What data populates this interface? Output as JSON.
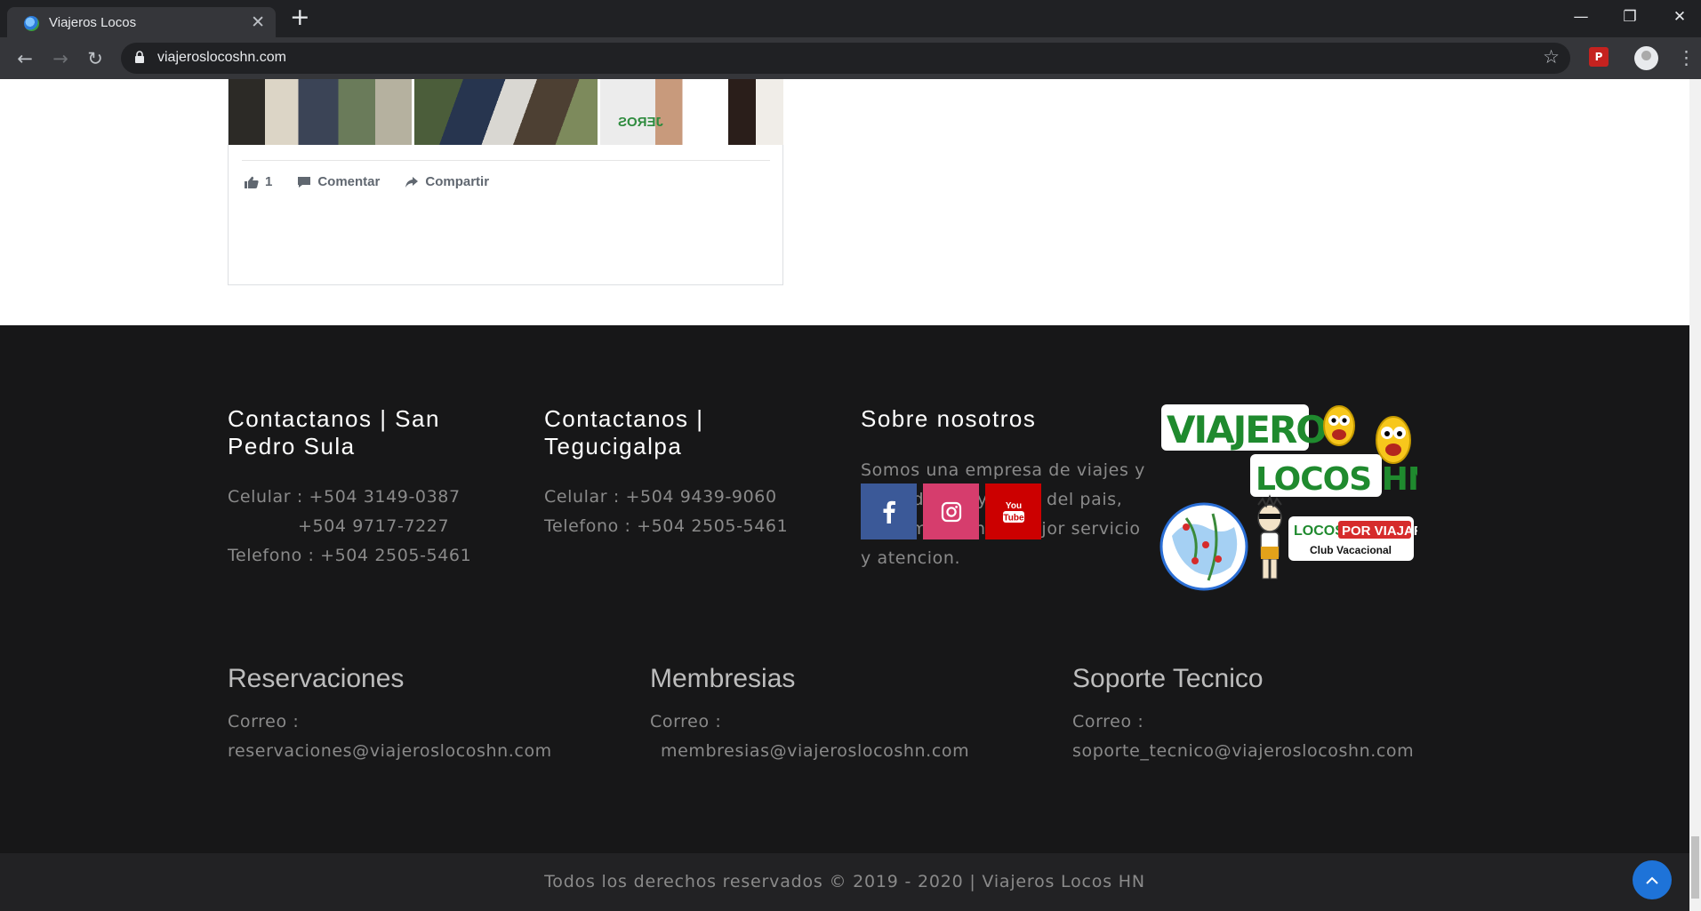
{
  "browser": {
    "tab_title": "Viajeros Locos",
    "url": "viajeroslocoshn.com",
    "extension_label": "P"
  },
  "fb_post": {
    "likes": "1",
    "comment_label": "Comentar",
    "share_label": "Compartir",
    "photo3_caption_text": "JEROS"
  },
  "footer": {
    "sps": {
      "title": "Contactanos | San Pedro Sula",
      "cel_label": "Celular : +504 3149-0387",
      "cel2": "+504 9717-7227",
      "tel": "Telefono : +504 2505-5461"
    },
    "tgu": {
      "title": "Contactanos | Tegucigalpa",
      "cel": "Celular : +504 9439-9060",
      "tel": "Telefono : +504 2505-5461"
    },
    "about": {
      "title": "Sobre nosotros",
      "text": "Somos una empresa de viajes y tours dentro y fuera del pais, contamos con el mejor servicio y atencion."
    },
    "social": {
      "facebook_icon": "facebook-icon",
      "instagram_icon": "instagram-icon",
      "youtube_icon": "youtube-icon",
      "facebook_color": "#3b5998",
      "instagram_color": "#d63d6d",
      "youtube_color": "#cc0000"
    },
    "logo": {
      "line1": "VIAJEROS",
      "line2": "LOCOS HN",
      "badge_part1": "LOCOS",
      "badge_part2": "POR VIAJAR",
      "badge_sub": "Club Vacacional"
    },
    "reservaciones": {
      "title": "Reservaciones",
      "label": "Correo :",
      "email": "reservaciones@viajeroslocoshn.com"
    },
    "membresias": {
      "title": "Membresias",
      "label": "Correo :",
      "email": "membresias@viajeroslocoshn.com"
    },
    "soporte": {
      "title": "Soporte Tecnico",
      "label": "Correo :",
      "email": "soporte_tecnico@viajeroslocoshn.com"
    },
    "copyright": "Todos los derechos reservados © 2019 - 2020 | Viajeros Locos HN"
  },
  "colors": {
    "footer_bg": "#171718",
    "copyright_bg": "#222224",
    "scroll_top": "#1e73d8"
  }
}
